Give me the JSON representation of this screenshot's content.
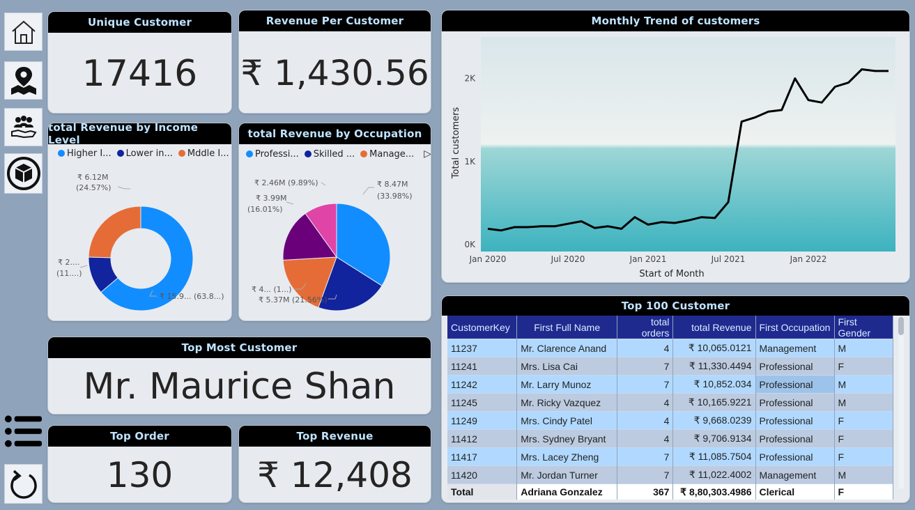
{
  "kpi": {
    "unique_customer": {
      "title": "Unique Customer",
      "value": "17416"
    },
    "revenue_per_customer": {
      "title": "Revenue Per Customer",
      "value": "₹ 1,430.56"
    },
    "top_most_customer": {
      "title": "Top Most Customer",
      "value": "Mr. Maurice Shan"
    },
    "top_order": {
      "title": "Top Order",
      "value": "130"
    },
    "top_revenue": {
      "title": "Top Revenue",
      "value": "₹ 12,408"
    }
  },
  "nav": {
    "icons": [
      "home-icon",
      "map-pin-icon",
      "customers-icon",
      "product-icon",
      "list-icon",
      "refresh-icon"
    ]
  },
  "income_chart": {
    "title": "total Revenue by Income Level",
    "legend": [
      "Higher I...",
      "Lower in...",
      "Mddle I..."
    ],
    "labels": [
      {
        "l1": "₹ 6.12M",
        "l2": "(24.57%)"
      },
      {
        "l1": "₹ 2....",
        "l2": "(11....)"
      },
      {
        "l1": "₹ 15.9... (63.8...)",
        "l2": ""
      }
    ]
  },
  "occupation_chart": {
    "title": "total Revenue by Occupation",
    "legend": [
      "Professi...",
      "Skilled ...",
      "Manage..."
    ],
    "labels": [
      {
        "l1": "₹ 8.47M",
        "l2": "(33.98%)"
      },
      {
        "l1": "₹ 2.46M (9.89%)",
        "l2": ""
      },
      {
        "l1": "₹ 3.99M",
        "l2": "(16.01%)"
      },
      {
        "l1": "₹ 4... (1...)",
        "l2": ""
      },
      {
        "l1": "₹ 5.37M (21.56%)",
        "l2": ""
      }
    ]
  },
  "trend_chart": {
    "title": "Monthly Trend of customers"
  },
  "table": {
    "title": "Top 100 Customer",
    "columns": [
      "CustomerKey",
      "First Full Name",
      "total orders",
      "total Revenue",
      "First Occupation",
      "First Gender"
    ],
    "rows": [
      [
        "11237",
        "Mr. Clarence Anand",
        "4",
        "₹ 10,065.0121",
        "Management",
        "M"
      ],
      [
        "11241",
        "Mrs. Lisa Cai",
        "7",
        "₹ 11,330.4494",
        "Professional",
        "F"
      ],
      [
        "11242",
        "Mr. Larry Munoz",
        "7",
        "₹ 10,852.034",
        "Professional",
        "M"
      ],
      [
        "11245",
        "Mr. Ricky Vazquez",
        "4",
        "₹ 10,165.9221",
        "Professional",
        "M"
      ],
      [
        "11249",
        "Mrs. Cindy Patel",
        "4",
        "₹ 9,668.0239",
        "Professional",
        "F"
      ],
      [
        "11412",
        "Mrs. Sydney Bryant",
        "4",
        "₹ 9,706.9134",
        "Professional",
        "F"
      ],
      [
        "11417",
        "Mrs. Lacey Zheng",
        "7",
        "₹ 11,085.7504",
        "Professional",
        "F"
      ],
      [
        "11420",
        "Mr. Jordan Turner",
        "7",
        "₹ 11,022.4002",
        "Management",
        "M"
      ]
    ],
    "total": [
      "Total",
      "Adriana Gonzalez",
      "367",
      "₹ 8,80,303.4986",
      "Clerical",
      "F"
    ]
  },
  "chart_data": [
    {
      "type": "pie",
      "title": "total Revenue by Income Level",
      "categories": [
        "Higher I...",
        "Lower in...",
        "Mddle I..."
      ],
      "values": [
        63.8,
        11.6,
        24.57
      ],
      "value_labels": [
        "₹ 15.9... (63.8...)",
        "₹ 2.... (11....)",
        "₹ 6.12M (24.57%)"
      ],
      "donut": true,
      "colors": [
        "#118dff",
        "#12239e",
        "#e66c37"
      ],
      "legend": "top-left"
    },
    {
      "type": "pie",
      "title": "total Revenue by Occupation",
      "categories": [
        "Professi...",
        "Skilled ...",
        "Manage...",
        "",
        ""
      ],
      "values": [
        33.98,
        21.56,
        18.56,
        16.01,
        9.89
      ],
      "value_labels": [
        "₹ 8.47M (33.98%)",
        "₹ 5.37M (21.56%)",
        "₹ 4... (1...)",
        "₹ 3.99M (16.01%)",
        "₹ 2.46M (9.89%)"
      ],
      "colors": [
        "#118dff",
        "#12239e",
        "#e66c37",
        "#6b007b",
        "#e044a7"
      ],
      "legend": "top-left"
    },
    {
      "type": "line",
      "title": "Monthly Trend of customers",
      "xlabel": "Start of Month",
      "ylabel": "Total customers",
      "x_ticks": [
        "Jan 2020",
        "Jul 2020",
        "Jan 2021",
        "Jul 2021",
        "Jan 2022"
      ],
      "y_ticks": [
        "0K",
        "1K",
        "2K"
      ],
      "ylim": [
        0,
        2500
      ],
      "x": [
        "2020-01",
        "2020-02",
        "2020-03",
        "2020-04",
        "2020-05",
        "2020-06",
        "2020-07",
        "2020-08",
        "2020-09",
        "2020-10",
        "2020-11",
        "2020-12",
        "2021-01",
        "2021-02",
        "2021-03",
        "2021-04",
        "2021-05",
        "2021-06",
        "2021-07",
        "2021-08",
        "2021-09",
        "2021-10",
        "2021-11",
        "2021-12",
        "2022-01",
        "2022-02",
        "2022-03",
        "2022-04",
        "2022-05",
        "2022-06",
        "2022-07"
      ],
      "series": [
        {
          "values": [
            190,
            170,
            210,
            210,
            220,
            220,
            250,
            280,
            200,
            220,
            190,
            330,
            240,
            270,
            260,
            290,
            330,
            320,
            510,
            1480,
            1530,
            1600,
            1620,
            2000,
            1740,
            1710,
            1900,
            1950,
            2110,
            2090,
            2090
          ]
        }
      ],
      "grid": false,
      "line_color": "#000000"
    }
  ]
}
